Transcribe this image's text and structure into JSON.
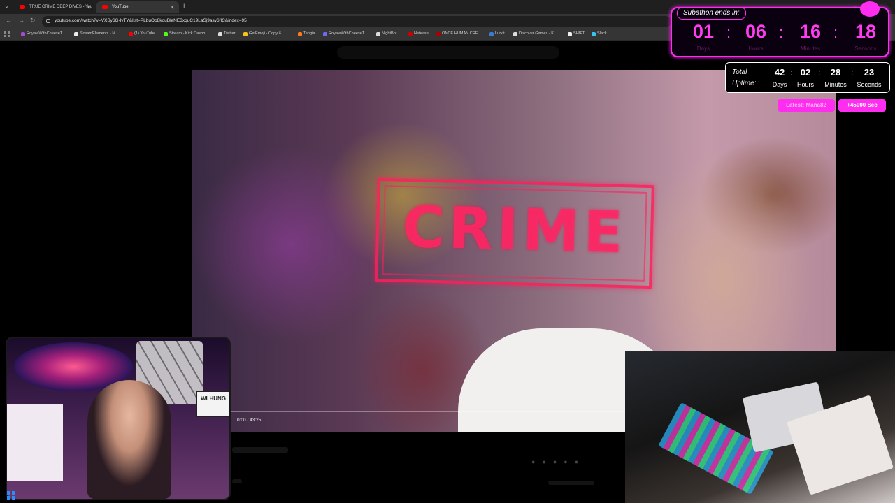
{
  "browser": {
    "tabs": [
      {
        "label": "TRUE CRIME DEEP DIVES - You",
        "active": false
      },
      {
        "label": "YouTube",
        "active": true
      }
    ],
    "url": "youtube.com/watch?v=VXSy6G-lvTY&list=PLbuOo8kouBleNE3xquC19LaSj9asy6fIC&index=95",
    "bookmarks": [
      "RoyaleWithCheeseT...",
      "StreamElements - M...",
      "(1) YouTube",
      "Stream - Kick Dashb...",
      "Twitter",
      "GetEmoji - Copy &...",
      "Tangia",
      "RoyaleWithCheeseT...",
      "NightBot",
      "Netease",
      "ONCE HUMAN CRE...",
      "Lurkit",
      "Discover Games - K...",
      "SHIFT",
      "Slack"
    ]
  },
  "video": {
    "overlay_text": "CRIME",
    "time": "0:00 / 43:25"
  },
  "subathon": {
    "title": "Subathon ends in:",
    "units": [
      {
        "value": "01",
        "label": "Days"
      },
      {
        "value": "06",
        "label": "Hours"
      },
      {
        "value": "16",
        "label": "Minutes"
      },
      {
        "value": "18",
        "label": "Seconds"
      }
    ],
    "separator": ":"
  },
  "uptime": {
    "title_line1": "Total",
    "title_line2": "Uptime:",
    "units": [
      {
        "value": "42",
        "label": "Days"
      },
      {
        "value": "02",
        "label": "Hours"
      },
      {
        "value": "28",
        "label": "Minutes"
      },
      {
        "value": "23",
        "label": "Seconds"
      }
    ],
    "separator": ":"
  },
  "pills": {
    "latest": "Latest: Mana82",
    "bonus": "+45000 Sec"
  },
  "webcam": {
    "sign_text": "WLHUNG"
  },
  "colors": {
    "accent": "#ff2df0",
    "crime_red": "#ff2864",
    "browser_bg": "#353535"
  }
}
